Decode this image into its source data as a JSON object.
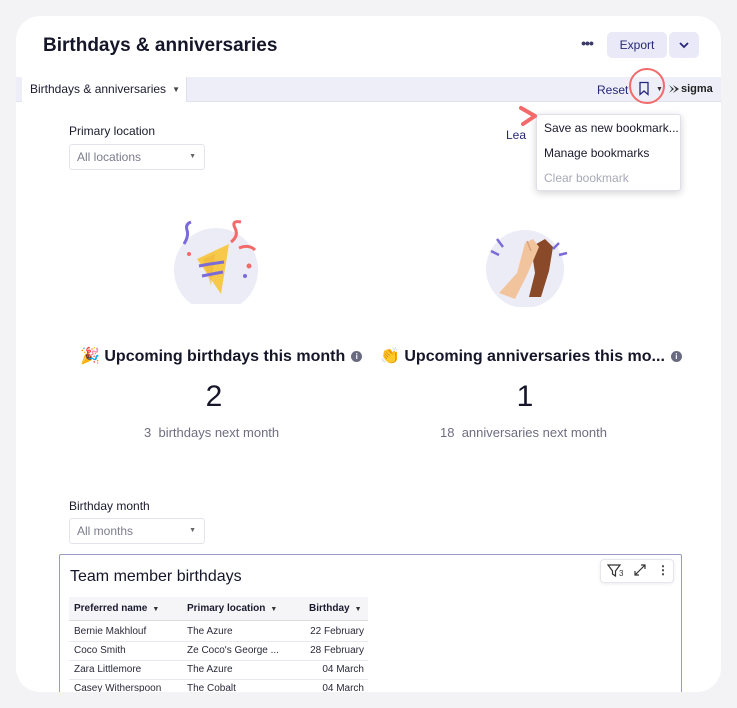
{
  "header": {
    "title": "Birthdays & anniversaries",
    "more_label": "•••",
    "export_label": "Export"
  },
  "toolbar": {
    "tab_label": "Birthdays & anniversaries",
    "reset_label": "Reset",
    "brand_label": "sigma"
  },
  "bookmark_menu": {
    "items": [
      {
        "label": "Save as new bookmark...",
        "enabled": true
      },
      {
        "label": "Manage bookmarks",
        "enabled": true
      },
      {
        "label": "Clear bookmark",
        "enabled": false
      }
    ]
  },
  "filters": {
    "primary_location": {
      "label": "Primary location",
      "value": "All locations"
    },
    "birthday_month": {
      "label": "Birthday month",
      "value": "All months"
    },
    "learn_link": "Lea"
  },
  "metrics": {
    "birthdays": {
      "emoji": "🎉",
      "title": "Upcoming birthdays this month",
      "value": "2",
      "sub_count": "3",
      "sub_text": "birthdays next month"
    },
    "anniversaries": {
      "emoji": "👏",
      "title": "Upcoming anniversaries this mo...",
      "value": "1",
      "sub_count": "18",
      "sub_text": "anniversaries next month"
    }
  },
  "table": {
    "title": "Team member birthdays",
    "filter_count": "3",
    "columns": [
      "Preferred name",
      "Primary location",
      "Birthday"
    ],
    "rows": [
      [
        "Bernie Makhlouf",
        "The Azure",
        "22 February"
      ],
      [
        "Coco Smith",
        "Ze Coco's George ...",
        "28 February"
      ],
      [
        "Zara Littlemore",
        "The Azure",
        "04 March"
      ],
      [
        "Casey Witherspoon",
        "The Cobalt",
        "04 March"
      ]
    ]
  },
  "colors": {
    "accent": "#26267a",
    "highlight_circle": "#f26a6a",
    "arrow": "#f26a6a",
    "toolbar_bg": "#eeeef8"
  }
}
